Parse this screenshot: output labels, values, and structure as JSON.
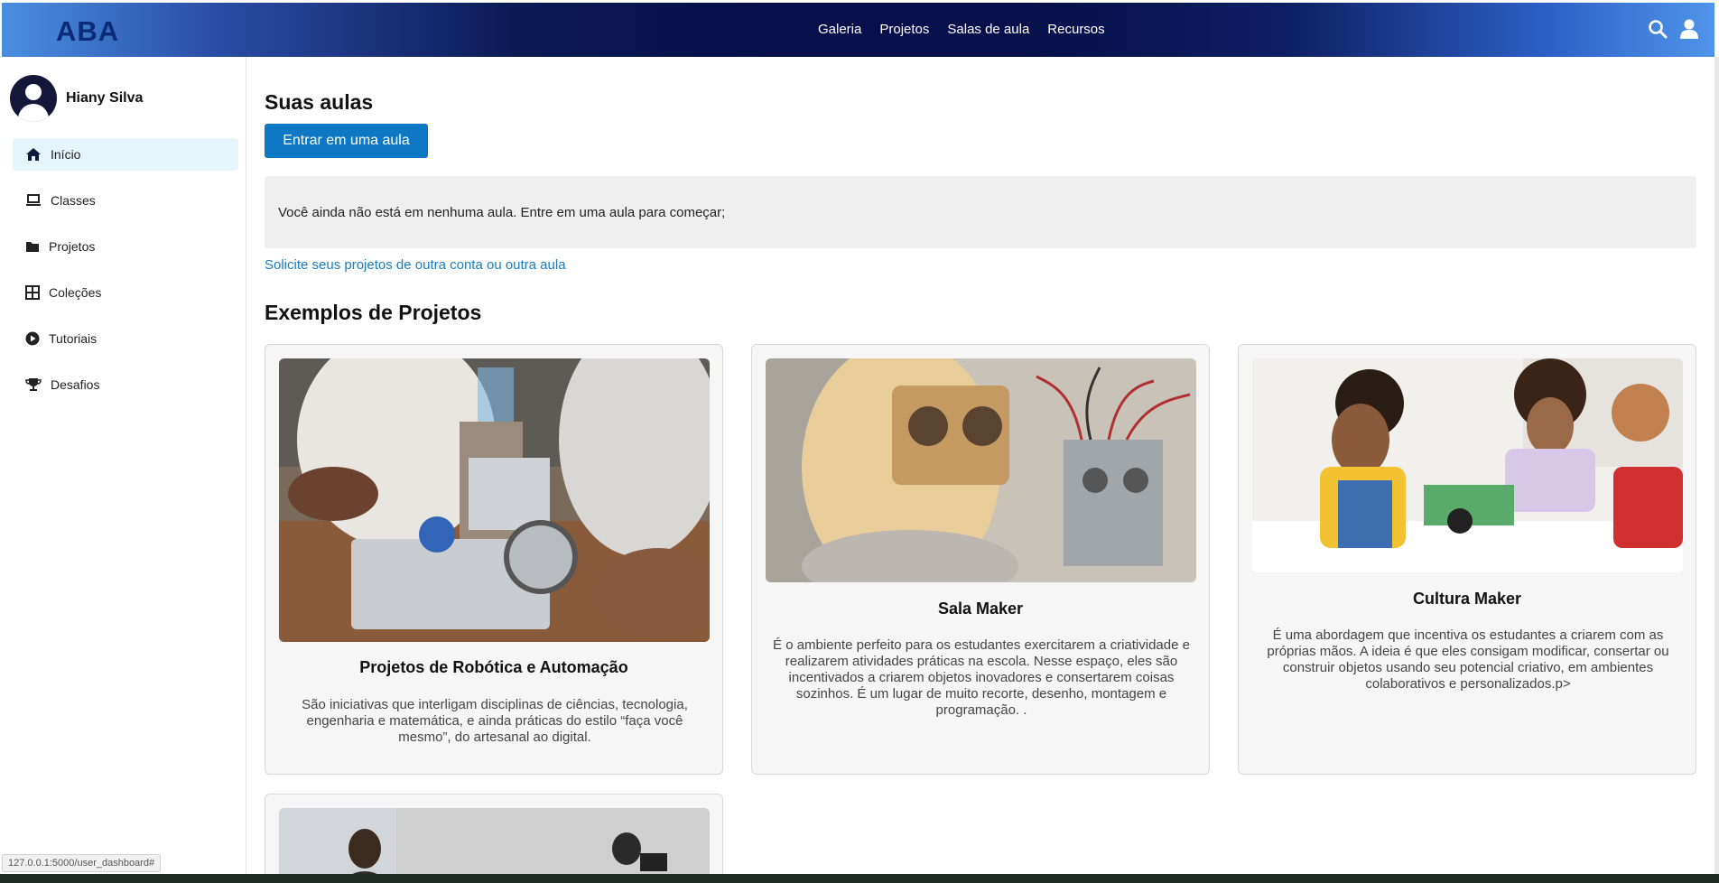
{
  "header": {
    "logo": "ABA",
    "nav": [
      "Galeria",
      "Projetos",
      "Salas de aula",
      "Recursos"
    ],
    "icons": [
      "search-icon",
      "user-icon"
    ]
  },
  "sidebar": {
    "user_name": "Hiany Silva",
    "items": [
      {
        "label": "Início",
        "icon": "home-icon",
        "active": true
      },
      {
        "label": "Classes",
        "icon": "laptop-icon",
        "active": false
      },
      {
        "label": "Projetos",
        "icon": "folder-icon",
        "active": false
      },
      {
        "label": "Coleções",
        "icon": "grid-icon",
        "active": false
      },
      {
        "label": "Tutoriais",
        "icon": "play-circle-icon",
        "active": false
      },
      {
        "label": "Desafios",
        "icon": "trophy-icon",
        "active": false
      }
    ]
  },
  "main": {
    "classes_heading": "Suas aulas",
    "join_button": "Entrar em uma aula",
    "notice": "Você ainda não está em nenhuma aula. Entre em uma aula para começar;",
    "request_link": "Solicite seus projetos de outra conta ou outra aula",
    "examples_heading": "Exemplos de Projetos",
    "cards": [
      {
        "title": "Projetos de Robótica e Automação",
        "description": "São iniciativas que interligam disciplinas de ciências, tecnologia, engenharia e matemática, e ainda práticas do estilo “faça você mesmo”, do artesanal ao digital."
      },
      {
        "title": "Sala Maker",
        "description": "É o ambiente perfeito para os estudantes exercitarem a criatividade e realizarem atividades práticas na escola. Nesse espaço, eles são incentivados a criarem objetos inovadores e consertarem coisas sozinhos. É um lugar de muito recorte, desenho, montagem e programação. ."
      },
      {
        "title": "Cultura Maker",
        "description": "É uma abordagem que incentiva os estudantes a criarem com as próprias mãos. A ideia é que eles consigam modificar, consertar ou construir objetos usando seu potencial criativo, em ambientes colaborativos e personalizados.p>"
      }
    ]
  },
  "status_url": "127.0.0.1:5000/user_dashboard#",
  "colors": {
    "accent": "#0e78c4",
    "link": "#1b7cc2",
    "active_item_bg": "#e6f4fc",
    "header_dark": "#07104a"
  }
}
